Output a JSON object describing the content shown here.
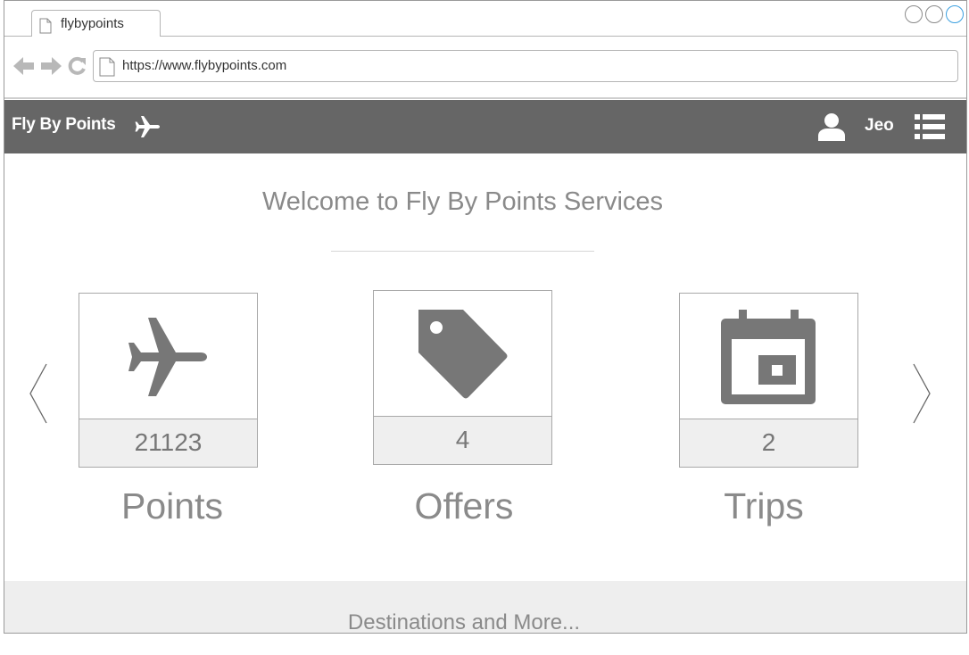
{
  "browser": {
    "tab_title": "flybypoints",
    "url": "https://www.flybypoints.com"
  },
  "header": {
    "brand": "Fly By Points",
    "username": "Jeo"
  },
  "main": {
    "welcome": "Welcome to Fly By Points Services",
    "cards": [
      {
        "icon": "airplane-icon",
        "count": "21123",
        "label": "Points"
      },
      {
        "icon": "tag-icon",
        "count": "4",
        "label": "Offers"
      },
      {
        "icon": "calendar-icon",
        "count": "2",
        "label": "Trips"
      }
    ]
  },
  "footer": {
    "text": "Destinations and More..."
  },
  "colors": {
    "header_bg": "#666666",
    "icon_gray": "#777777",
    "text_gray": "#8a8a8a",
    "count_bg": "#efefef"
  }
}
